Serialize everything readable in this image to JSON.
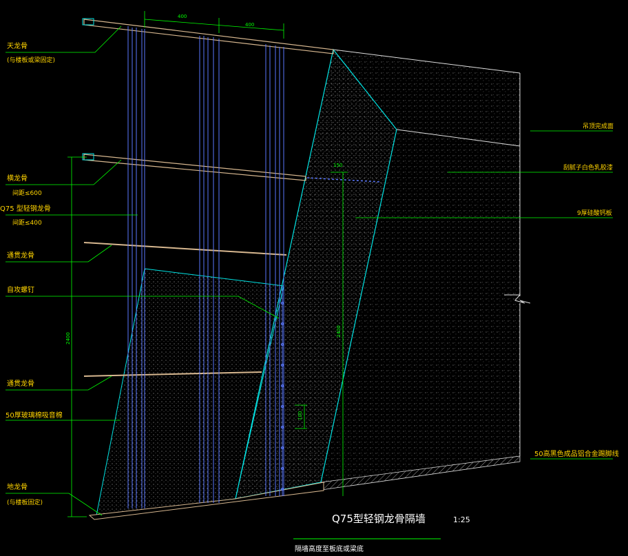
{
  "drawing": {
    "title": "Q75型轻钢龙骨隔墙",
    "scale": "1:25",
    "subtitle": "隔墙高度至板底或梁底"
  },
  "dimensions": {
    "top_spacing_1": "400",
    "top_spacing_2": "400",
    "left_height": "2400",
    "mid_height": "2400",
    "small_150": "150",
    "small_100": "100"
  },
  "labels_left": {
    "top_runner": "天龙骨",
    "top_runner_note": "(与楼板或梁固定)",
    "horizontal_runner": "横龙骨",
    "horizontal_spacing": "间距≤600",
    "stud": "Q75 型轻钢龙骨",
    "stud_spacing": "间距≤400",
    "through_runner_1": "通贯龙骨",
    "self_tapping_screw": "自攻螺钉",
    "through_runner_2": "通贯龙骨",
    "glass_wool": "50厚玻璃棉吸音棉",
    "bottom_runner": "地龙骨",
    "bottom_runner_note": "(与楼板固定)"
  },
  "labels_right": {
    "ceiling_finish": "吊顶完成面",
    "paint": "刮腻子白色乳胶漆",
    "gypsum_board": "9厚硅酸钙板",
    "skirting": "50高黑色成品铝合金踢脚线"
  },
  "colors": {
    "background": "#000000",
    "label_yellow": "#ffd400",
    "leader_green": "#00ff00",
    "board_cyan": "#00e5e5",
    "stud_blue": "#5a78ff",
    "runner_tan": "#d8b890"
  }
}
